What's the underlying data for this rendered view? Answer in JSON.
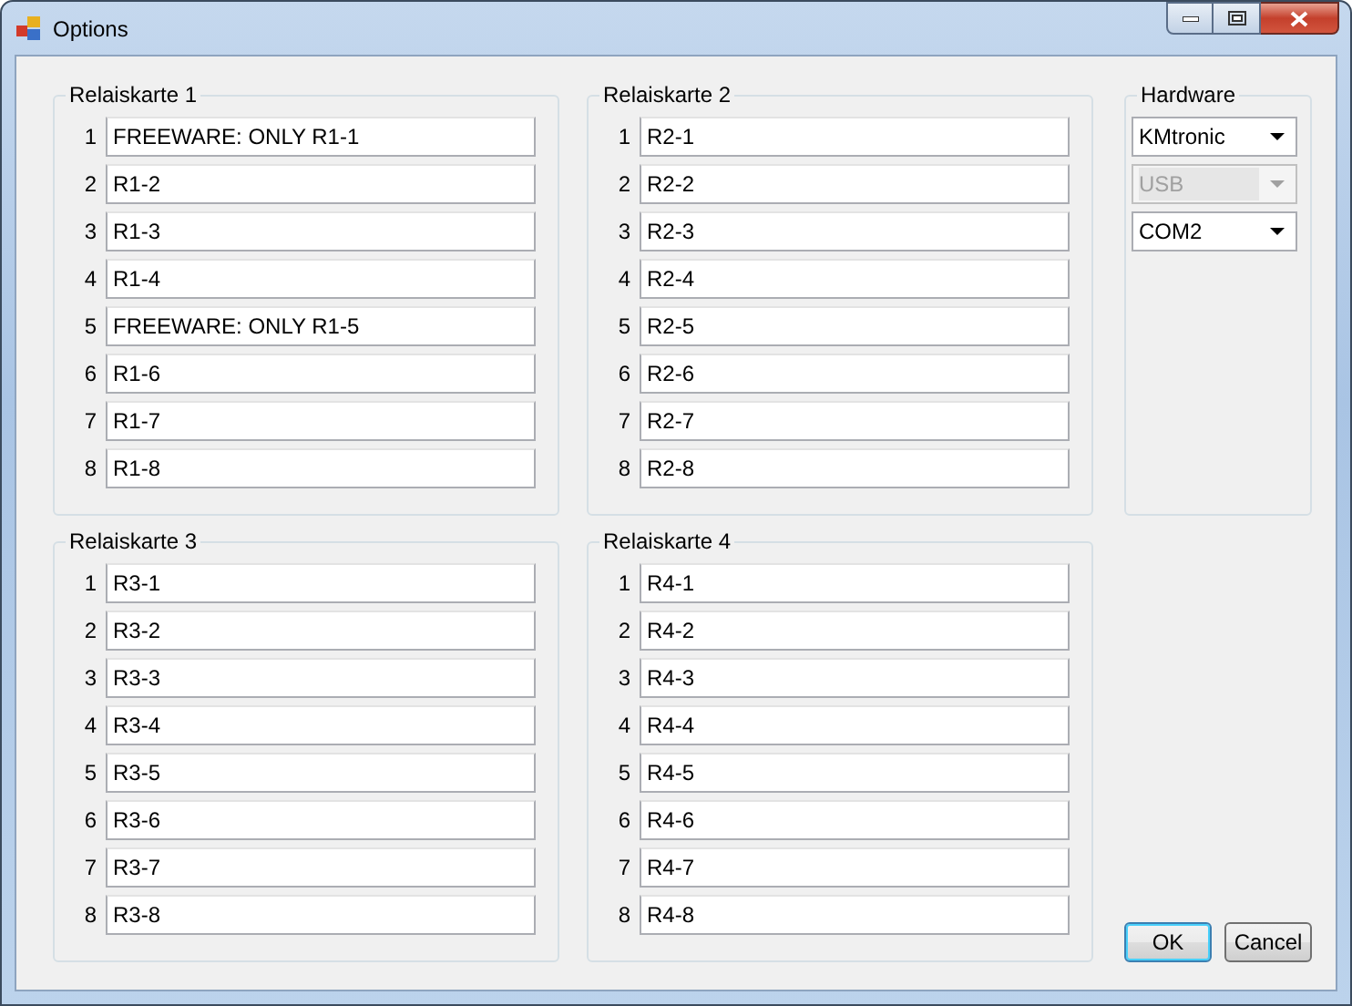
{
  "window": {
    "title": "Options"
  },
  "groups": [
    {
      "title": "Relaiskarte 1",
      "rows": [
        {
          "number": "1",
          "value": "FREEWARE: ONLY R1-1"
        },
        {
          "number": "2",
          "value": "R1-2"
        },
        {
          "number": "3",
          "value": "R1-3"
        },
        {
          "number": "4",
          "value": "R1-4"
        },
        {
          "number": "5",
          "value": "FREEWARE: ONLY R1-5"
        },
        {
          "number": "6",
          "value": "R1-6"
        },
        {
          "number": "7",
          "value": "R1-7"
        },
        {
          "number": "8",
          "value": "R1-8"
        }
      ]
    },
    {
      "title": "Relaiskarte 2",
      "rows": [
        {
          "number": "1",
          "value": "R2-1"
        },
        {
          "number": "2",
          "value": "R2-2"
        },
        {
          "number": "3",
          "value": "R2-3"
        },
        {
          "number": "4",
          "value": "R2-4"
        },
        {
          "number": "5",
          "value": "R2-5"
        },
        {
          "number": "6",
          "value": "R2-6"
        },
        {
          "number": "7",
          "value": "R2-7"
        },
        {
          "number": "8",
          "value": "R2-8"
        }
      ]
    },
    {
      "title": "Relaiskarte 3",
      "rows": [
        {
          "number": "1",
          "value": "R3-1"
        },
        {
          "number": "2",
          "value": "R3-2"
        },
        {
          "number": "3",
          "value": "R3-3"
        },
        {
          "number": "4",
          "value": "R3-4"
        },
        {
          "number": "5",
          "value": "R3-5"
        },
        {
          "number": "6",
          "value": "R3-6"
        },
        {
          "number": "7",
          "value": "R3-7"
        },
        {
          "number": "8",
          "value": "R3-8"
        }
      ]
    },
    {
      "title": "Relaiskarte 4",
      "rows": [
        {
          "number": "1",
          "value": "R4-1"
        },
        {
          "number": "2",
          "value": "R4-2"
        },
        {
          "number": "3",
          "value": "R4-3"
        },
        {
          "number": "4",
          "value": "R4-4"
        },
        {
          "number": "5",
          "value": "R4-5"
        },
        {
          "number": "6",
          "value": "R4-6"
        },
        {
          "number": "7",
          "value": "R4-7"
        },
        {
          "number": "8",
          "value": "R4-8"
        }
      ]
    }
  ],
  "hardware": {
    "title": "Hardware",
    "combos": [
      {
        "value": "KMtronic",
        "disabled": false
      },
      {
        "value": "USB",
        "disabled": true
      },
      {
        "value": "COM2",
        "disabled": false
      }
    ]
  },
  "buttons": [
    {
      "label": "OK",
      "default": true
    },
    {
      "label": "Cancel",
      "default": false
    }
  ]
}
